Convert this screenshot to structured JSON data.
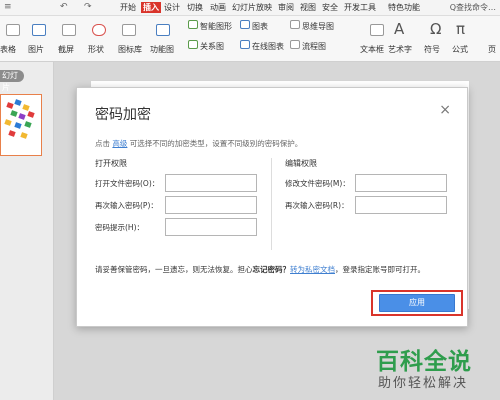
{
  "toolbar": {
    "menu_icon": "≡",
    "undo_icon": "↶",
    "redo_icon": "↷",
    "tabs": [
      "开始",
      "插入",
      "设计",
      "切换",
      "动画",
      "幻灯片放映",
      "审阅",
      "视图",
      "安全",
      "开发工具",
      "特色功能"
    ],
    "active_tab": "插入",
    "search": "Q查找命令…"
  },
  "ribbon": {
    "table": "表格",
    "picture": "图片",
    "screenshot": "截屏",
    "shape": "形状",
    "icon_library": "图标库",
    "function_chart": "功能图",
    "smart_shape": "智能图形",
    "relation_chart": "关系图",
    "chart": "图表",
    "online_chart": "在线图表",
    "mindmap": "思维导图",
    "flowchart": "流程图",
    "textbox": "文本框",
    "art_text": "艺术字",
    "symbol": "符号",
    "formula": "公式",
    "header": "页"
  },
  "left_panel": {
    "pill": "幻灯片"
  },
  "dialog": {
    "title": "密码加密",
    "close": "×",
    "tip_prefix": "点击",
    "tip_link": "高级",
    "tip_suffix": "可选择不同的加密类型，设置不同级别的密码保护。",
    "open_section": "打开权限",
    "edit_section": "编辑权限",
    "open_password_label": "打开文件密码(O)：",
    "open_reenter_label": "再次输入密码(P)：",
    "hint_label": "密码提示(H)：",
    "edit_password_label": "修改文件密码(M)：",
    "edit_reenter_label": "再次输入密码(R)：",
    "warn_text": "请妥善保管密码，一旦遗忘，则无法恢复。担心",
    "warn_bold": "忘记密码？",
    "warn_link": "转为私密文档",
    "warn_suffix": "，登录指定账号即可打开。",
    "apply_button": "应用"
  },
  "watermark": {
    "brand": "百科全说",
    "slogan": "助你轻松解决"
  }
}
